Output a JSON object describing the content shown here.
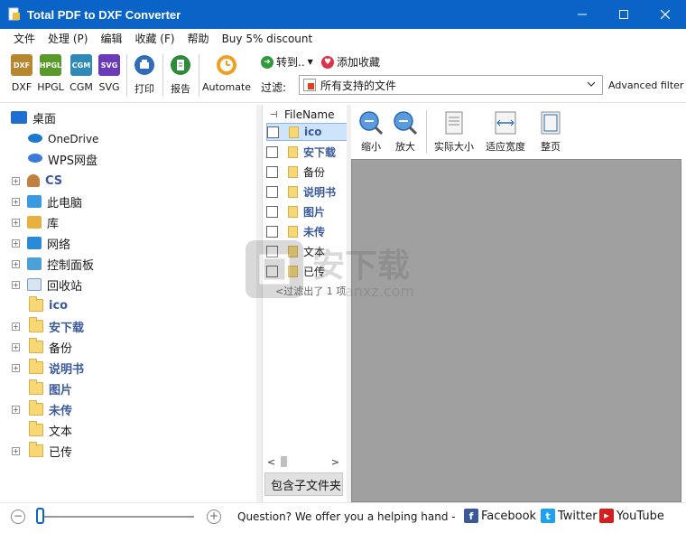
{
  "window": {
    "title": "Total PDF to DXF Converter",
    "minimize_icon": "minimize-icon",
    "maximize_icon": "maximize-icon",
    "close_icon": "close-icon"
  },
  "menu": [
    "文件",
    "处理 (P)",
    "编辑",
    "收藏 (F)",
    "帮助",
    "Buy 5% discount"
  ],
  "toolbar": {
    "formats": [
      {
        "label": "DXF",
        "badge": "DXF",
        "color": "#b8862f"
      },
      {
        "label": "HPGL",
        "badge": "HPGL",
        "color": "#5a9a2a"
      },
      {
        "label": "CGM",
        "badge": "CGM",
        "color": "#2f8ab8"
      },
      {
        "label": "SVG",
        "badge": "SVG",
        "color": "#6a3ab8"
      }
    ],
    "print_label": "打印",
    "report_label": "报告",
    "automate_label": "Automate",
    "convert_label": "转到..",
    "favorite_label": "添加收藏",
    "filter_label": "过滤:",
    "filter_value": "所有支持的文件",
    "advanced_filter": "Advanced filter"
  },
  "tree": [
    {
      "label": "桌面",
      "icon": "desktop-icon",
      "expander": false,
      "indent": 0,
      "style": "normal"
    },
    {
      "label": "OneDrive",
      "icon": "cloud-icon",
      "expander": false,
      "indent": 1,
      "style": "normal"
    },
    {
      "label": "WPS网盘",
      "icon": "cloud-icon",
      "expander": false,
      "indent": 1,
      "style": "normal"
    },
    {
      "label": "CS",
      "icon": "user-icon",
      "expander": true,
      "indent": 1,
      "style": "bold"
    },
    {
      "label": "此电脑",
      "icon": "computer-icon",
      "expander": true,
      "indent": 1,
      "style": "normal"
    },
    {
      "label": "库",
      "icon": "library-icon",
      "expander": true,
      "indent": 1,
      "style": "normal"
    },
    {
      "label": "网络",
      "icon": "network-icon",
      "expander": true,
      "indent": 1,
      "style": "normal"
    },
    {
      "label": "控制面板",
      "icon": "control-panel-icon",
      "expander": true,
      "indent": 1,
      "style": "normal"
    },
    {
      "label": "回收站",
      "icon": "recycle-bin-icon",
      "expander": true,
      "indent": 1,
      "style": "normal"
    },
    {
      "label": "ico",
      "icon": "folder-icon",
      "expander": false,
      "indent": 1,
      "style": "bold"
    },
    {
      "label": "安下载",
      "icon": "folder-icon",
      "expander": true,
      "indent": 1,
      "style": "bold"
    },
    {
      "label": "备份",
      "icon": "folder-icon",
      "expander": true,
      "indent": 1,
      "style": "normal"
    },
    {
      "label": "说明书",
      "icon": "folder-icon",
      "expander": true,
      "indent": 1,
      "style": "bold"
    },
    {
      "label": "图片",
      "icon": "folder-icon",
      "expander": false,
      "indent": 1,
      "style": "bold"
    },
    {
      "label": "未传",
      "icon": "folder-icon",
      "expander": true,
      "indent": 1,
      "style": "bold"
    },
    {
      "label": "文本",
      "icon": "folder-icon",
      "expander": false,
      "indent": 1,
      "style": "normal"
    },
    {
      "label": "已传",
      "icon": "folder-icon",
      "expander": true,
      "indent": 1,
      "style": "normal"
    }
  ],
  "filelist": {
    "header": "FileName",
    "rows": [
      {
        "name": "ico",
        "bold": true,
        "selected": true
      },
      {
        "name": "安下载",
        "bold": true,
        "selected": false
      },
      {
        "name": "备份",
        "bold": false,
        "selected": false
      },
      {
        "name": "说明书",
        "bold": true,
        "selected": false
      },
      {
        "name": "图片",
        "bold": true,
        "selected": false
      },
      {
        "name": "未传",
        "bold": true,
        "selected": false
      },
      {
        "name": "文本",
        "bold": false,
        "selected": false
      },
      {
        "name": "已传",
        "bold": false,
        "selected": false
      }
    ],
    "filtered_note": "<过滤出了 1 项",
    "subfolder_button": "包含子文件夹",
    "scroll_left": "<",
    "scroll_right": ">"
  },
  "preview": {
    "buttons": [
      "缩小",
      "放大",
      "实际大小",
      "适应宽度",
      "整页"
    ]
  },
  "status": {
    "zoom_minus": "−",
    "zoom_plus": "+",
    "help_text": "Question? We offer you a helping hand -",
    "facebook": "Facebook",
    "twitter": "Twitter",
    "youtube": "YouTube"
  }
}
